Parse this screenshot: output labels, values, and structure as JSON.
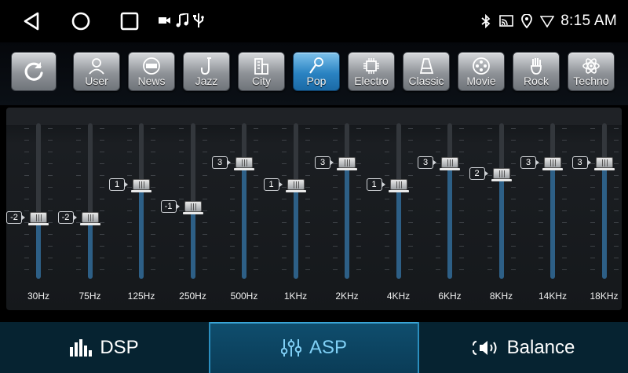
{
  "status_bar": {
    "time": "8:15 AM",
    "left_icons": [
      "video-icon",
      "music-icon",
      "usb-icon"
    ],
    "right_icons": [
      "bluetooth-icon",
      "cast-icon",
      "location-icon",
      "wifi-icon"
    ]
  },
  "presets": {
    "reset_icon": "refresh-icon",
    "active": "Pop",
    "items": [
      {
        "label": "User",
        "icon": "user-icon"
      },
      {
        "label": "News",
        "icon": "news-icon"
      },
      {
        "label": "Jazz",
        "icon": "saxophone-icon"
      },
      {
        "label": "City",
        "icon": "city-icon"
      },
      {
        "label": "Pop",
        "icon": "microphone-icon"
      },
      {
        "label": "Electro",
        "icon": "chip-icon"
      },
      {
        "label": "Classic",
        "icon": "piano-icon"
      },
      {
        "label": "Movie",
        "icon": "film-reel-icon"
      },
      {
        "label": "Rock",
        "icon": "guitar-icon"
      },
      {
        "label": "Techno",
        "icon": "atom-icon"
      }
    ]
  },
  "equalizer": {
    "min": -7,
    "max": 7,
    "bands": [
      {
        "freq": "30Hz",
        "value": -2,
        "value_label": "-2"
      },
      {
        "freq": "75Hz",
        "value": -2,
        "value_label": "-2"
      },
      {
        "freq": "125Hz",
        "value": 1,
        "value_label": "1"
      },
      {
        "freq": "250Hz",
        "value": -1,
        "value_label": "-1"
      },
      {
        "freq": "500Hz",
        "value": 3,
        "value_label": "3"
      },
      {
        "freq": "1KHz",
        "value": 1,
        "value_label": "1"
      },
      {
        "freq": "2KHz",
        "value": 3,
        "value_label": "3"
      },
      {
        "freq": "4KHz",
        "value": 1,
        "value_label": "1"
      },
      {
        "freq": "6KHz",
        "value": 3,
        "value_label": "3"
      },
      {
        "freq": "8KHz",
        "value": 2,
        "value_label": "2"
      },
      {
        "freq": "14KHz",
        "value": 3,
        "value_label": "3"
      },
      {
        "freq": "18KHz",
        "value": 3,
        "value_label": "3"
      }
    ]
  },
  "tabs": [
    {
      "label": "DSP",
      "icon": "equalizer-bars-icon",
      "active": false
    },
    {
      "label": "ASP",
      "icon": "sliders-icon",
      "active": true
    },
    {
      "label": "Balance",
      "icon": "speaker-icon",
      "active": false
    }
  ],
  "colors": {
    "accent": "#2a83c2",
    "tab_active_text": "#7fcff5",
    "slider_fill": "#2d5f86"
  }
}
